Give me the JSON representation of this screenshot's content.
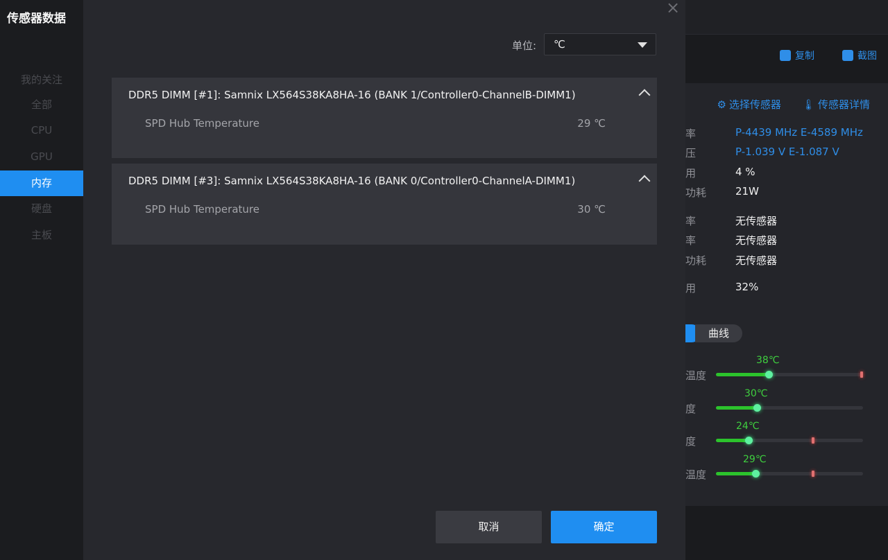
{
  "sidebar": {
    "title": "传感器数据",
    "group_label": "我的关注",
    "items": [
      {
        "label": "全部"
      },
      {
        "label": "CPU"
      },
      {
        "label": "GPU"
      },
      {
        "label": "内存"
      },
      {
        "label": "硬盘"
      },
      {
        "label": "主板"
      }
    ],
    "active_index": 3
  },
  "modal": {
    "close_symbol": "×",
    "unit_label": "单位:",
    "unit_value": "℃",
    "cards": [
      {
        "title": "DDR5 DIMM [#1]: Samnix LX564S38KA8HA-16 (BANK 1/Controller0-ChannelB-DIMM1)",
        "sensor": "SPD Hub Temperature",
        "value": "29 ℃"
      },
      {
        "title": "DDR5 DIMM [#3]: Samnix LX564S38KA8HA-16 (BANK 0/Controller0-ChannelA-DIMM1)",
        "sensor": "SPD Hub Temperature",
        "value": "30 ℃"
      }
    ],
    "cancel_label": "取消",
    "ok_label": "确定"
  },
  "background": {
    "copy_label": "复制",
    "screenshot_label": "截图",
    "select_sensor_label": "选择传感器",
    "sensor_detail_label": "传感器详情",
    "rows": [
      {
        "key": "率",
        "value": "P-4439 MHz  E-4589 MHz",
        "blue": true
      },
      {
        "key": "压",
        "value": "P-1.039 V  E-1.087 V",
        "blue": true
      },
      {
        "key": "用",
        "value": "4 %"
      },
      {
        "key": "功耗",
        "value": "21W"
      },
      {
        "key": "率",
        "value": "无传感器"
      },
      {
        "key": "率",
        "value": "无传感器"
      },
      {
        "key": "功耗",
        "value": "无传感器"
      },
      {
        "key": "用",
        "value": "32%"
      }
    ],
    "tab_label": "曲线",
    "temps": [
      {
        "label": "温度",
        "value": "38℃",
        "level": 0.36,
        "mark": 0.98
      },
      {
        "label": "度",
        "value": "30℃",
        "level": 0.28,
        "mark": null
      },
      {
        "label": "度",
        "value": "24℃",
        "level": 0.22,
        "mark": 0.65
      },
      {
        "label": "温度",
        "value": "29℃",
        "level": 0.27,
        "mark": 0.65
      }
    ],
    "colors": {
      "accent": "#1f8ef1",
      "temp_green": "#3fcf3f"
    }
  }
}
